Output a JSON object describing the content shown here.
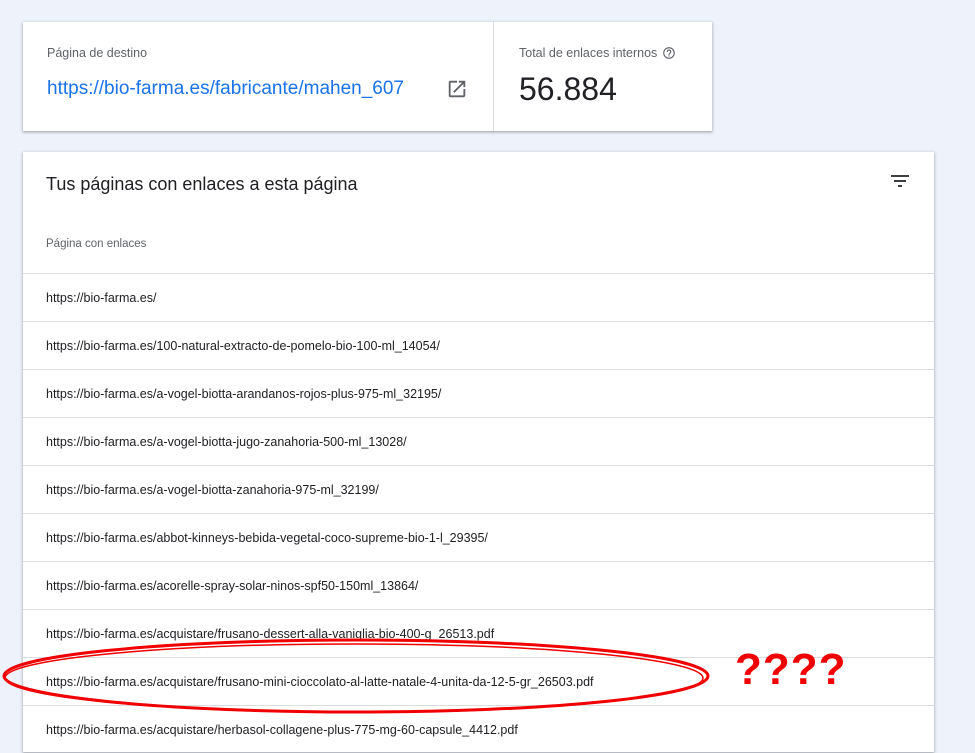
{
  "summary": {
    "destination_label": "Página de destino",
    "destination_url": "https://bio-farma.es/fabricante/mahen_607",
    "total_label": "Total de enlaces internos",
    "total_value": "56.884"
  },
  "links": {
    "title": "Tus páginas con enlaces a esta página",
    "column_header": "Página con enlaces",
    "rows": [
      "https://bio-farma.es/",
      "https://bio-farma.es/100-natural-extracto-de-pomelo-bio-100-ml_14054/",
      "https://bio-farma.es/a-vogel-biotta-arandanos-rojos-plus-975-ml_32195/",
      "https://bio-farma.es/a-vogel-biotta-jugo-zanahoria-500-ml_13028/",
      "https://bio-farma.es/a-vogel-biotta-zanahoria-975-ml_32199/",
      "https://bio-farma.es/abbot-kinneys-bebida-vegetal-coco-supreme-bio-1-l_29395/",
      "https://bio-farma.es/acorelle-spray-solar-ninos-spf50-150ml_13864/",
      "https://bio-farma.es/acquistare/frusano-dessert-alla-vaniglia-bio-400-g_26513.pdf",
      "https://bio-farma.es/acquistare/frusano-mini-cioccolato-al-latte-natale-4-unita-da-12-5-gr_26503.pdf",
      "https://bio-farma.es/acquistare/herbasol-collagene-plus-775-mg-60-capsule_4412.pdf"
    ]
  },
  "annotation": {
    "text": "????",
    "color": "#f00000"
  },
  "icons": {
    "open": "open-in-new-icon",
    "help": "help-icon",
    "filter": "filter-icon"
  },
  "colors": {
    "link": "#1a73e8",
    "background": "#eef2fb"
  }
}
